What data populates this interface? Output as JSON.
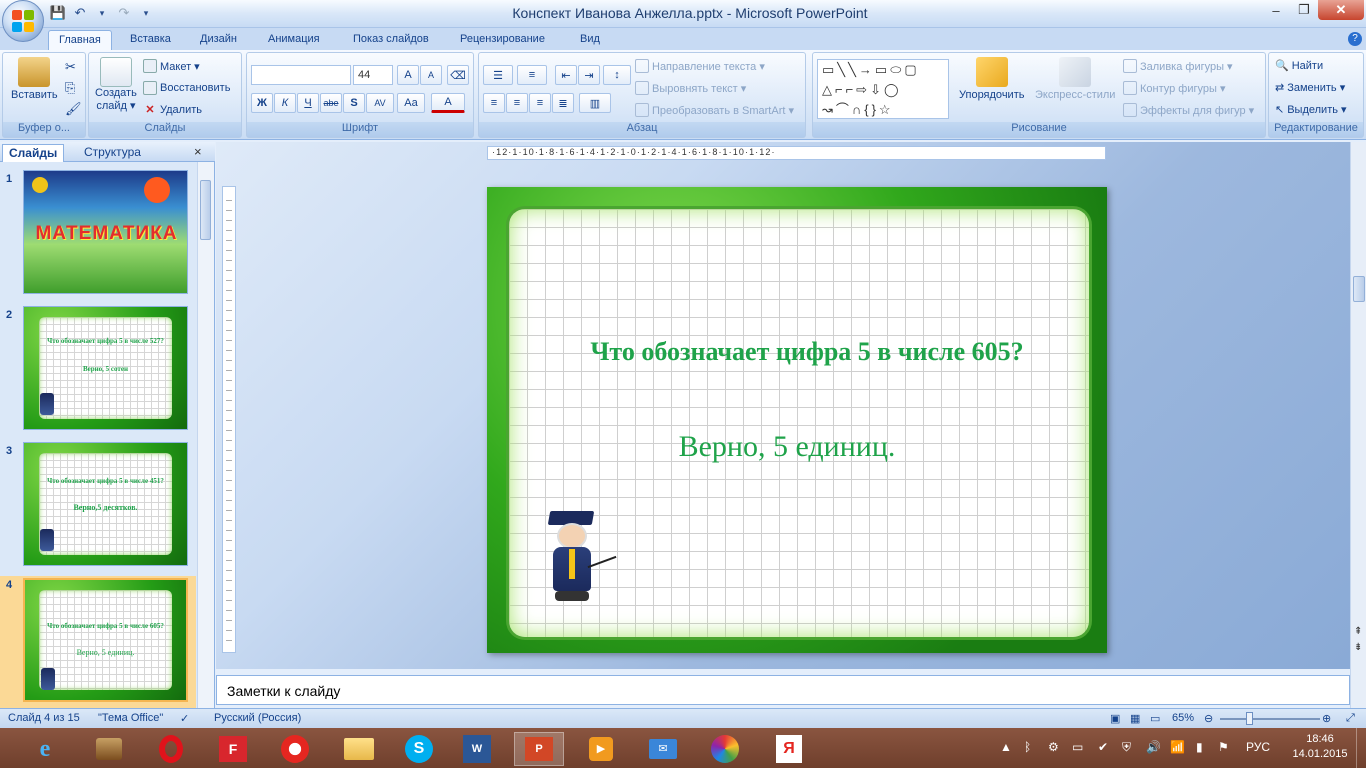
{
  "window": {
    "title": "Конспект Иванова Анжелла.pptx - Microsoft PowerPoint",
    "controls": [
      "–",
      "❐",
      "✕"
    ]
  },
  "tabs": [
    "Главная",
    "Вставка",
    "Дизайн",
    "Анимация",
    "Показ слайдов",
    "Рецензирование",
    "Вид"
  ],
  "ribbon": {
    "clipboard": {
      "paste": "Вставить",
      "label": "Буфер о..."
    },
    "slides": {
      "create": "Создать",
      "create2": "слайд ▾",
      "layout": "Макет ▾",
      "reset": "Восстановить",
      "delete": "Удалить",
      "label": "Слайды"
    },
    "font": {
      "size": "44",
      "label": "Шрифт",
      "buttons": [
        "Ж",
        "К",
        "Ч",
        "abe",
        "S",
        "AV",
        "Aa",
        "A"
      ]
    },
    "paragraph": {
      "dir": "Направление текста ▾",
      "align": "Выровнять текст ▾",
      "smartart": "Преобразовать в SmartArt ▾",
      "label": "Абзац"
    },
    "drawing": {
      "arrange": "Упорядочить",
      "express": "Экспресс-стили",
      "fill": "Заливка фигуры ▾",
      "outline": "Контур фигуры ▾",
      "effects": "Эффекты для фигур ▾",
      "label": "Рисование"
    },
    "editing": {
      "find": "Найти",
      "replace": "Заменить ▾",
      "select": "Выделить ▾",
      "label": "Редактирование"
    }
  },
  "leftpane": {
    "tab_slides": "Слайды",
    "tab_outline": "Структура",
    "close": "×",
    "thumbs": [
      {
        "num": "1",
        "title": "МАТЕМАТИКА"
      },
      {
        "num": "2",
        "q": "Что обозначает цифра 5 в числе 527?",
        "a": "Верно, 5 сотен"
      },
      {
        "num": "3",
        "q": "Что обозначает цифра 5 в числе 451?",
        "a": "Верно,5 десятков."
      },
      {
        "num": "4",
        "q": "Что обозначает цифра 5 в числе 605?",
        "a": "Верно, 5 единиц."
      }
    ]
  },
  "ruler": {
    "h": "·12·1·10·1·8·1·6·1·4·1·2·1·0·1·2·1·4·1·6·1·8·1·10·1·12·"
  },
  "slide": {
    "question": "Что обозначает цифра 5 в числе 605?",
    "answer": "Верно, 5 единиц."
  },
  "notes": {
    "placeholder": "Заметки к слайду"
  },
  "status": {
    "slide": "Слайд 4 из 15",
    "theme": "\"Тема Office\"",
    "lang": "Русский (Россия)",
    "zoom": "65%"
  },
  "tray": {
    "lang": "РУС",
    "time": "18:46",
    "date": "14.01.2015"
  },
  "colors": {
    "accent": "#1fa34a",
    "ribbon": "#dbe8f8",
    "taskbar": "#7a4632"
  }
}
